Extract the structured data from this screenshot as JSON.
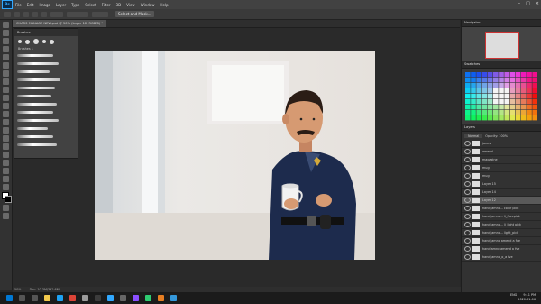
{
  "menu": {
    "logo": "Ps",
    "items": [
      "File",
      "Edit",
      "Image",
      "Layer",
      "Type",
      "Select",
      "Filter",
      "3D",
      "View",
      "Window",
      "Help"
    ]
  },
  "options_bar": {
    "select_subject": "Select and Mask..."
  },
  "document_tab": {
    "title": "CHARS MANAGE NEW.psd @ 50% (Layer 12, RGB/8) *"
  },
  "brush_panel": {
    "title": "Brushes",
    "group": "Brushes 1"
  },
  "status_bar": {
    "zoom": "50%",
    "doc": "Doc: 10.3M/392.6M"
  },
  "panels": {
    "navigator": "Navigator",
    "swatches": "Swatches",
    "layers": "Layers"
  },
  "layers_panel": {
    "mode": "Normal",
    "opacity": "Opacity: 100%",
    "items": [
      {
        "name": "jones",
        "selected": false
      },
      {
        "name": "amend",
        "selected": false
      },
      {
        "name": "magazine",
        "selected": false
      },
      {
        "name": "mug",
        "selected": false
      },
      {
        "name": "mug",
        "selected": false
      },
      {
        "name": "Layer 15",
        "selected": false
      },
      {
        "name": "Layer 14",
        "selected": false
      },
      {
        "name": "Layer 12",
        "selected": true
      },
      {
        "name": "hand_amnc... color pick",
        "selected": false
      },
      {
        "name": "hand_amnc... li_facepick",
        "selected": false
      },
      {
        "name": "hand_amnc... li_light pick",
        "selected": false
      },
      {
        "name": "hand_amnc... light_pick",
        "selected": false
      },
      {
        "name": "hand_amnc amend a fve",
        "selected": false
      },
      {
        "name": "hand amnc amend a fve",
        "selected": false
      },
      {
        "name": "hand_amnc_o_a fve",
        "selected": false
      }
    ]
  },
  "taskbar": {
    "icons": [
      {
        "name": "windows-icon",
        "color": "#0078d4"
      },
      {
        "name": "search-icon",
        "color": "#555555"
      },
      {
        "name": "taskview-icon",
        "color": "#555555"
      },
      {
        "name": "explorer-icon",
        "color": "#f2c94c"
      },
      {
        "name": "edge-icon",
        "color": "#1da1f2"
      },
      {
        "name": "chrome-icon",
        "color": "#db4437"
      },
      {
        "name": "files-icon",
        "color": "#9b9b9b"
      },
      {
        "name": "obs-icon",
        "color": "#3c3c3c"
      },
      {
        "name": "photoshop-icon",
        "color": "#31a8ff"
      },
      {
        "name": "app-icon-1",
        "color": "#666666"
      },
      {
        "name": "app-icon-2",
        "color": "#8a4fff"
      },
      {
        "name": "app-icon-3",
        "color": "#2ecc71"
      },
      {
        "name": "app-icon-4",
        "color": "#e67e22"
      },
      {
        "name": "app-icon-5",
        "color": "#3498db"
      }
    ],
    "language": "ENG",
    "time": "9:11 PM",
    "date": "2020-01-06"
  }
}
